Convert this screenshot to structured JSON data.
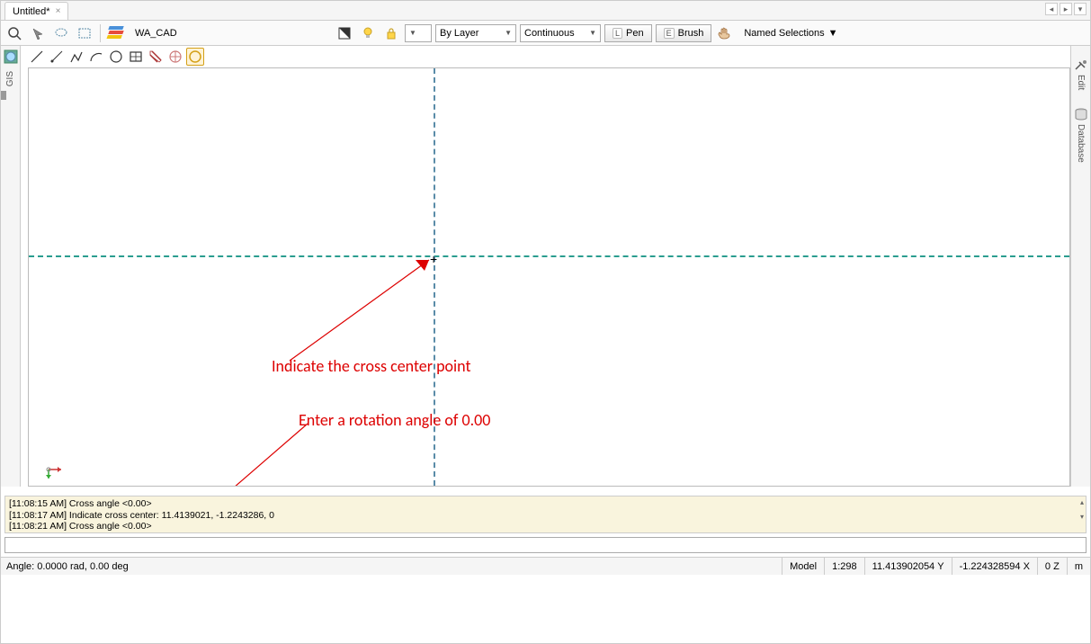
{
  "tab": {
    "title": "Untitled*"
  },
  "toolbar": {
    "layer_name": "WA_CAD",
    "layer_style": "By Layer",
    "linetype": "Continuous",
    "pen_key": "L",
    "pen_label": "Pen",
    "brush_key": "E",
    "brush_label": "Brush",
    "named_selections": "Named Selections"
  },
  "side": {
    "left_label": "GIS",
    "right_top": "Edit",
    "right_bottom": "Database"
  },
  "annotations": {
    "line1": "Indicate the cross center point",
    "line2": "Enter a rotation angle of 0.00"
  },
  "command_log": [
    "[11:08:15 AM] Cross angle <0.00>",
    "[11:08:17 AM] Indicate cross center: 11.4139021, -1.2243286, 0",
    "[11:08:21 AM] Cross angle <0.00>"
  ],
  "status": {
    "angle": "Angle: 0.0000 rad, 0.00 deg",
    "model": "Model",
    "scale": "1:298",
    "x": "11.413902054",
    "x_label": "Y",
    "y": "-1.224328594",
    "y_label": "X",
    "z": "0",
    "z_label": "Z",
    "unit": "m"
  }
}
